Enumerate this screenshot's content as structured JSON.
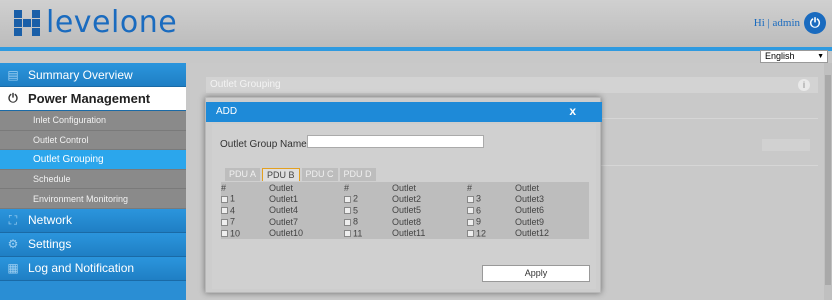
{
  "header": {
    "logo_text": "levelone",
    "user_text": "Hi | admin",
    "language": "English"
  },
  "sidebar": {
    "items": [
      {
        "label": "Summary Overview",
        "icon": "document-icon"
      },
      {
        "label": "Power Management",
        "icon": "power-icon",
        "expanded": true,
        "children": [
          {
            "label": "Inlet Configuration"
          },
          {
            "label": "Outlet Control"
          },
          {
            "label": "Outlet Grouping",
            "active": true
          },
          {
            "label": "Schedule"
          },
          {
            "label": "Environment Monitoring"
          }
        ]
      },
      {
        "label": "Network",
        "icon": "network-icon"
      },
      {
        "label": "Settings",
        "icon": "gear-icon"
      },
      {
        "label": "Log and Notification",
        "icon": "log-icon"
      }
    ]
  },
  "main": {
    "panel_title": "Outlet Grouping"
  },
  "modal": {
    "title": "ADD",
    "close": "x",
    "group_name_label": "Outlet Group Name:",
    "group_name_value": "",
    "tabs": [
      "PDU A",
      "PDU B",
      "PDU C",
      "PDU D"
    ],
    "active_tab": "PDU B",
    "columns": [
      "#",
      "Outlet",
      "#",
      "Outlet",
      "#",
      "Outlet"
    ],
    "rows": [
      [
        {
          "n": "1",
          "o": "Outlet1"
        },
        {
          "n": "2",
          "o": "Outlet2"
        },
        {
          "n": "3",
          "o": "Outlet3"
        }
      ],
      [
        {
          "n": "4",
          "o": "Outlet4"
        },
        {
          "n": "5",
          "o": "Outlet5"
        },
        {
          "n": "6",
          "o": "Outlet6"
        }
      ],
      [
        {
          "n": "7",
          "o": "Outlet7"
        },
        {
          "n": "8",
          "o": "Outlet8"
        },
        {
          "n": "9",
          "o": "Outlet9"
        }
      ],
      [
        {
          "n": "10",
          "o": "Outlet10"
        },
        {
          "n": "11",
          "o": "Outlet11"
        },
        {
          "n": "12",
          "o": "Outlet12"
        }
      ]
    ],
    "apply_label": "Apply"
  },
  "colors": {
    "accent": "#1e8ad8",
    "sidebar_blue": "#2a8ed4",
    "active_sub": "#2ba6ec",
    "brand": "#1a6bbf"
  }
}
